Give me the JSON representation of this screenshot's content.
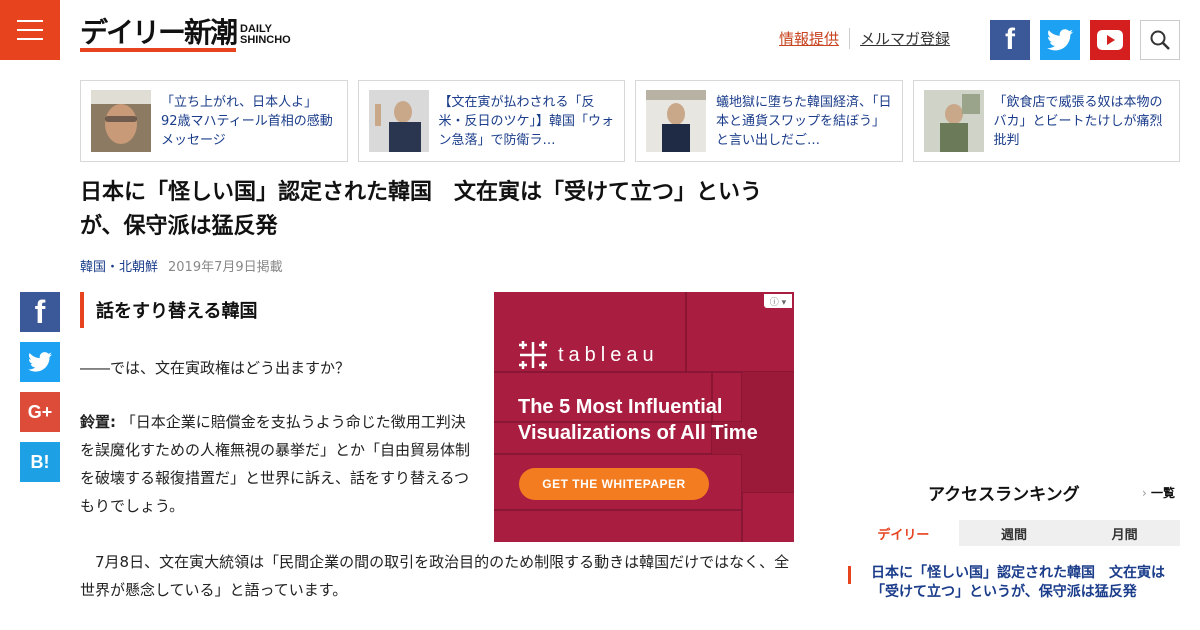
{
  "header": {
    "logo_main": "デイリー新潮",
    "logo_sub_1": "DAILY",
    "logo_sub_2": "SHINCHO",
    "link_info": "情報提供",
    "link_mail": "メルマガ登録",
    "accent": "#e8431f",
    "icons": [
      "menu-icon",
      "facebook-icon",
      "twitter-icon",
      "youtube-icon",
      "search-icon"
    ]
  },
  "related": [
    {
      "text": "「立ち上がれ、日本人よ」　92歳マハティール首相の感動メッセージ"
    },
    {
      "text": "【文在寅が払わされる「反米・反日のツケ」】韓国「ウォン急落」で防衛ラ…"
    },
    {
      "text": "蟻地獄に堕ちた韓国経済、「日本と通貨スワップを結ぼう」と言い出しだご…"
    },
    {
      "text": "「飲食店で威張る奴は本物のバカ」とビートたけしが痛烈批判"
    }
  ],
  "article": {
    "title": "日本に「怪しい国」認定された韓国　文在寅は「受けて立つ」というが、保守派は猛反発",
    "category": "韓国・北朝鮮",
    "date": "2019年7月9日掲載",
    "section_heading": "話をすり替える韓国",
    "p1": "――では、文在寅政権はどう出ますか？",
    "p2_speaker": "鈴置:",
    "p2_text": " 「日本企業に賠償金を支払うよう命じた徴用工判決を誤魔化すための人権無視の暴挙だ」とか「自由貿易体制を破壊する報復措置だ」と世界に訴え、話をすり替えるつもりでしょう。",
    "p3": "7月8日、文在寅大統領は「民間企業の間の取引を政治目的のため制限する動きは韓国だけではなく、全世界が懸念している」と語っています。"
  },
  "share": {
    "fb": "f",
    "gplus": "G+",
    "hatena": "B!"
  },
  "ad": {
    "brand": "tableau",
    "headline": "The 5 Most Influential Visualizations of All Time",
    "cta": "GET THE WHITEPAPER",
    "bg": "#a91e40",
    "cta_color": "#f47c20"
  },
  "ranking": {
    "title": "アクセスランキング",
    "more": "一覧",
    "tabs": [
      "デイリー",
      "週間",
      "月間"
    ],
    "first_item": "日本に「怪しい国」認定された韓国　文在寅は「受けて立つ」というが、保守派は猛反発"
  }
}
